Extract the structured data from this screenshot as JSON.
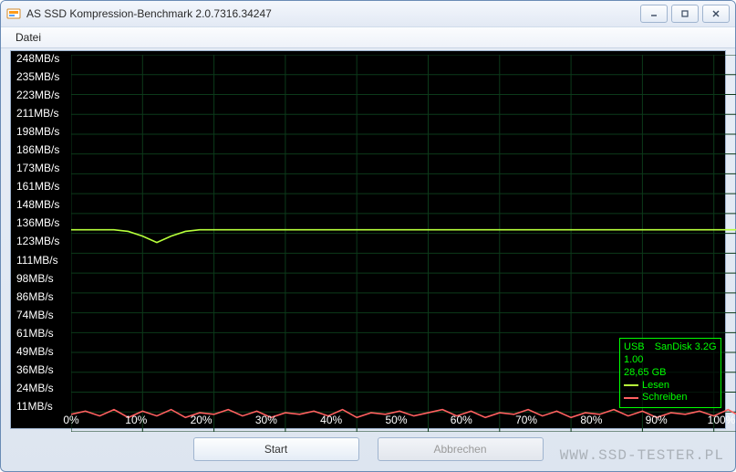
{
  "window": {
    "title": "AS SSD Kompression-Benchmark 2.0.7316.34247"
  },
  "menu": {
    "datei": "Datei"
  },
  "buttons": {
    "start": "Start",
    "abort": "Abbrechen"
  },
  "watermark": "WWW.SSD-TESTER.PL",
  "legend": {
    "device": "SanDisk 3.2G",
    "iface": "USB",
    "fw": "1.00",
    "capacity": "28,65 GB",
    "read_label": "Lesen",
    "write_label": "Schreiben"
  },
  "chart_data": {
    "type": "line",
    "title": "",
    "xlabel": "",
    "ylabel": "",
    "xlim": [
      0,
      100
    ],
    "ylim": [
      11,
      248
    ],
    "x_ticks": [
      "0%",
      "10%",
      "20%",
      "30%",
      "40%",
      "50%",
      "60%",
      "70%",
      "80%",
      "90%",
      "100%"
    ],
    "y_ticks": [
      "248MB/s",
      "235MB/s",
      "223MB/s",
      "211MB/s",
      "198MB/s",
      "186MB/s",
      "173MB/s",
      "161MB/s",
      "148MB/s",
      "136MB/s",
      "123MB/s",
      "111MB/s",
      "98MB/s",
      "86MB/s",
      "74MB/s",
      "61MB/s",
      "49MB/s",
      "36MB/s",
      "24MB/s",
      "11MB/s"
    ],
    "x": [
      0,
      2,
      4,
      6,
      8,
      10,
      12,
      14,
      16,
      18,
      20,
      22,
      24,
      26,
      28,
      30,
      32,
      34,
      36,
      38,
      40,
      42,
      44,
      46,
      48,
      50,
      52,
      54,
      56,
      58,
      60,
      62,
      64,
      66,
      68,
      70,
      72,
      74,
      76,
      78,
      80,
      82,
      84,
      86,
      88,
      90,
      92,
      94,
      96,
      98,
      100
    ],
    "series": [
      {
        "name": "Lesen",
        "color": "#b7ff3b",
        "values": [
          138,
          138,
          138,
          138,
          137,
          134,
          130,
          134,
          137,
          138,
          138,
          138,
          138,
          138,
          138,
          138,
          138,
          138,
          138,
          138,
          138,
          138,
          138,
          138,
          138,
          138,
          138,
          138,
          138,
          138,
          138,
          138,
          138,
          138,
          138,
          138,
          138,
          138,
          138,
          138,
          138,
          138,
          138,
          138,
          138,
          138,
          138,
          138,
          138,
          138,
          138
        ]
      },
      {
        "name": "Schreiben",
        "color": "#ff6060",
        "values": [
          22,
          24,
          21,
          25,
          20,
          24,
          21,
          25,
          20,
          23,
          22,
          25,
          21,
          24,
          20,
          23,
          22,
          24,
          21,
          25,
          20,
          23,
          22,
          24,
          21,
          23,
          25,
          21,
          24,
          20,
          23,
          22,
          25,
          21,
          24,
          20,
          23,
          22,
          25,
          21,
          24,
          20,
          23,
          22,
          24,
          21,
          25,
          20,
          23,
          22,
          24
        ]
      }
    ]
  }
}
